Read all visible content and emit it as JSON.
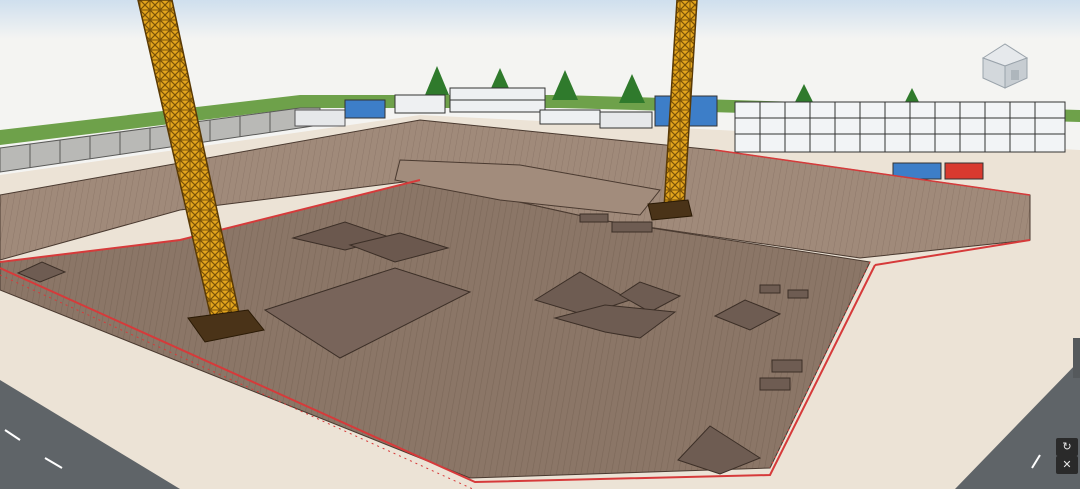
{
  "viewer": {
    "view_cube_icon": "home-view-cube-icon",
    "refresh_icon": "refresh-icon",
    "close_icon": "close-icon",
    "refresh_glyph": "↻",
    "close_glyph": "✕"
  },
  "colors": {
    "sky": "#dfe9f2",
    "ground": "#ece3d6",
    "pit_floor": "#8a7565",
    "pit_wall": "#9c8676",
    "fence": "#d63a3a",
    "crane": "#e0a81a",
    "road": "#5f6468",
    "grass": "#6ea14a",
    "office_blue": "#3d7ec8",
    "office_red": "#d83a2f"
  }
}
